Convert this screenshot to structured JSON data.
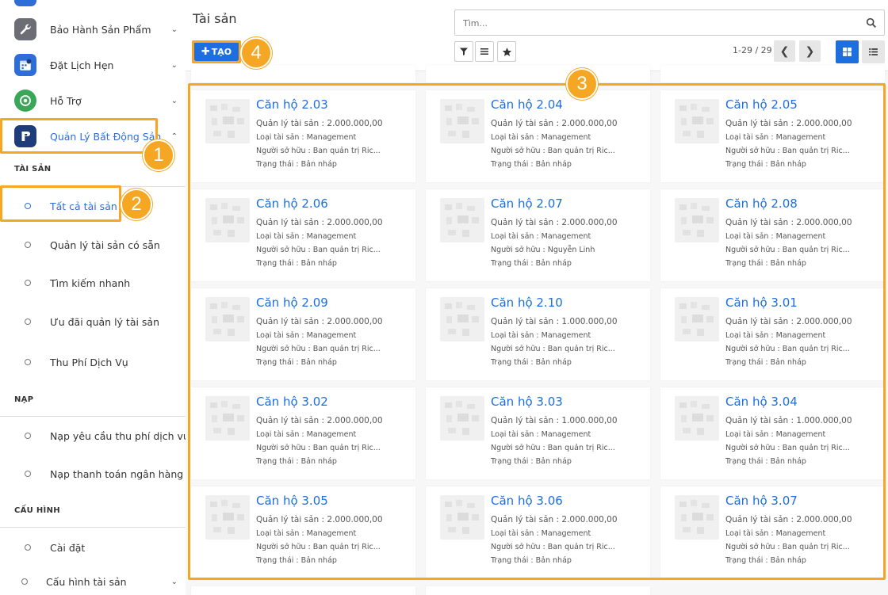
{
  "sidebar": {
    "apps": [
      {
        "label": "Bảo Hành Sản Phẩm",
        "icon": "wrench-icon"
      },
      {
        "label": "Đặt Lịch Hẹn",
        "icon": "calendar-icon"
      },
      {
        "label": "Hỗ Trợ",
        "icon": "support-icon"
      },
      {
        "label": "Quản Lý Bất Động Sản",
        "icon": "real-estate-icon"
      }
    ],
    "sections": [
      {
        "title": "TÀI SẢN",
        "items": [
          "Tất cả tài sản",
          "Quản lý tài sản có sẵn",
          "Tìm kiếm nhanh",
          "Ưu đãi quản lý tài sản",
          "Thu Phí Dịch Vụ"
        ]
      },
      {
        "title": "NẠP",
        "items": [
          "Nạp yêu cầu thu phí dịch vụ",
          "Nạp thanh toán ngân hàng"
        ]
      },
      {
        "title": "CẤU HÌNH",
        "items": [
          "Cài đặt",
          "Cấu hình tài sản"
        ]
      }
    ]
  },
  "header": {
    "title": "Tài sản",
    "create_label": "TẠO",
    "search_placeholder": "Tìm...",
    "pager": "1-29 / 29"
  },
  "badges": [
    "1",
    "2",
    "3",
    "4"
  ],
  "colors": {
    "accent": "#1d6fe0",
    "highlight": "#f5a623"
  },
  "cards": [
    {
      "title": "Căn hộ 2.03",
      "fee": "Quản lý tài sản : 2.000.000,00",
      "type": "Loại tài sản : Management",
      "owner": "Người sở hữu : Ban quản trị Ric...",
      "status": "Trạng thái : Bản nháp"
    },
    {
      "title": "Căn hộ 2.04",
      "fee": "Quản lý tài sản : 2.000.000,00",
      "type": "Loại tài sản : Management",
      "owner": "Người sở hữu : Ban quản trị Ric...",
      "status": "Trạng thái : Bản nháp"
    },
    {
      "title": "Căn hộ 2.05",
      "fee": "Quản lý tài sản : 2.000.000,00",
      "type": "Loại tài sản : Management",
      "owner": "Người sở hữu : Ban quản trị Ric...",
      "status": "Trạng thái : Bản nháp"
    },
    {
      "title": "Căn hộ 2.06",
      "fee": "Quản lý tài sản : 2.000.000,00",
      "type": "Loại tài sản : Management",
      "owner": "Người sở hữu : Ban quản trị Ric...",
      "status": "Trạng thái : Bản nháp"
    },
    {
      "title": "Căn hộ 2.07",
      "fee": "Quản lý tài sản : 2.000.000,00",
      "type": "Loại tài sản : Management",
      "owner": "Người sở hữu : Nguyễn Linh",
      "status": "Trạng thái : Bản nháp"
    },
    {
      "title": "Căn hộ 2.08",
      "fee": "Quản lý tài sản : 2.000.000,00",
      "type": "Loại tài sản : Management",
      "owner": "Người sở hữu : Ban quản trị Ric...",
      "status": "Trạng thái : Bản nháp"
    },
    {
      "title": "Căn hộ 2.09",
      "fee": "Quản lý tài sản : 2.000.000,00",
      "type": "Loại tài sản : Management",
      "owner": "Người sở hữu : Ban quản trị Ric...",
      "status": "Trạng thái : Bản nháp"
    },
    {
      "title": "Căn hộ 2.10",
      "fee": "Quản lý tài sản : 1.000.000,00",
      "type": "Loại tài sản : Management",
      "owner": "Người sở hữu : Ban quản trị Ric...",
      "status": "Trạng thái : Bản nháp"
    },
    {
      "title": "Căn hộ 3.01",
      "fee": "Quản lý tài sản : 2.000.000,00",
      "type": "Loại tài sản : Management",
      "owner": "Người sở hữu : Ban quản trị Ric...",
      "status": "Trạng thái : Bản nháp"
    },
    {
      "title": "Căn hộ 3.02",
      "fee": "Quản lý tài sản : 2.000.000,00",
      "type": "Loại tài sản : Management",
      "owner": "Người sở hữu : Ban quản trị Ric...",
      "status": "Trạng thái : Bản nháp"
    },
    {
      "title": "Căn hộ 3.03",
      "fee": "Quản lý tài sản : 1.000.000,00",
      "type": "Loại tài sản : Management",
      "owner": "Người sở hữu : Ban quản trị Ric...",
      "status": "Trạng thái : Bản nháp"
    },
    {
      "title": "Căn hộ 3.04",
      "fee": "Quản lý tài sản : 1.000.000,00",
      "type": "Loại tài sản : Management",
      "owner": "Người sở hữu : Ban quản trị Ric...",
      "status": "Trạng thái : Bản nháp"
    },
    {
      "title": "Căn hộ 3.05",
      "fee": "Quản lý tài sản : 2.000.000,00",
      "type": "Loại tài sản : Management",
      "owner": "Người sở hữu : Ban quản trị Ric...",
      "status": "Trạng thái : Bản nháp"
    },
    {
      "title": "Căn hộ 3.06",
      "fee": "Quản lý tài sản : 2.000.000,00",
      "type": "Loại tài sản : Management",
      "owner": "Người sở hữu : Ban quản trị Ric...",
      "status": "Trạng thái : Bản nháp"
    },
    {
      "title": "Căn hộ 3.07",
      "fee": "Quản lý tài sản : 2.000.000,00",
      "type": "Loại tài sản : Management",
      "owner": "Người sở hữu : Ban quản trị Ric...",
      "status": "Trạng thái : Bản nháp"
    }
  ]
}
